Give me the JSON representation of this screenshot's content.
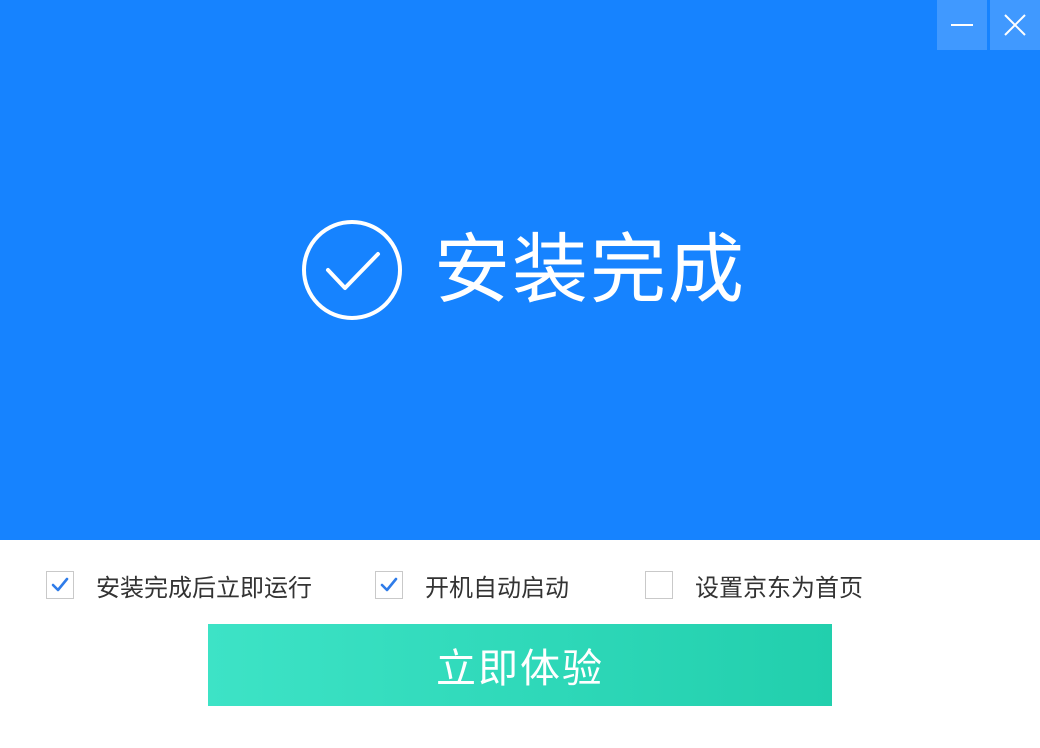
{
  "window": {
    "minimize_icon": "minimize-icon",
    "close_icon": "close-icon",
    "accent_color": "#1683ff"
  },
  "status": {
    "icon": "check-circle-icon",
    "title": "安装完成"
  },
  "options": [
    {
      "label": "安装完成后立即运行",
      "checked": true
    },
    {
      "label": "开机自动启动",
      "checked": true
    },
    {
      "label": "设置京东为首页",
      "checked": false
    }
  ],
  "action": {
    "label": "立即体验",
    "color": "#2dd9b9"
  }
}
